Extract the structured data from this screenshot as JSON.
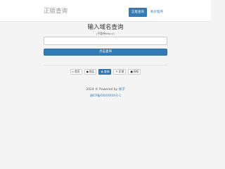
{
  "header": {
    "brand": "正版查询",
    "nav": [
      {
        "label": "正版查询",
        "active": true
      },
      {
        "label": "购买程序",
        "active": false
      }
    ]
  },
  "search": {
    "title": "输入域名查询",
    "hint": "(不要带http://)",
    "input_value": "",
    "input_placeholder": "",
    "submit_label": "点击查询"
  },
  "links": [
    {
      "label": "首页",
      "icon": "home-icon"
    },
    {
      "label": "购买",
      "icon": "cart-icon"
    },
    {
      "label": "查询",
      "icon": "user-icon",
      "active": true
    },
    {
      "label": "反馈",
      "icon": "pencil-icon"
    },
    {
      "label": "授权",
      "icon": "lock-icon"
    }
  ],
  "footer": {
    "copyright_prefix": "2024 © Powered by",
    "author": "易子",
    "icp": "湘ICP备XXXXXXXX号-1"
  },
  "colors": {
    "primary": "#337ab7",
    "background": "#f4f4f4",
    "navbar": "#ffffff"
  }
}
